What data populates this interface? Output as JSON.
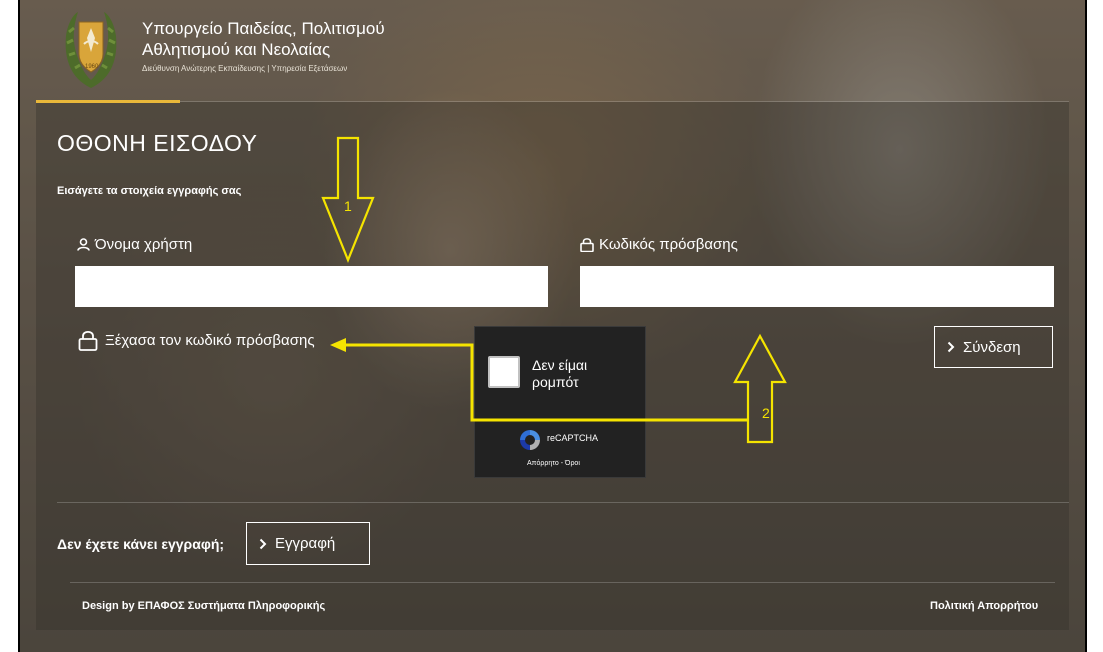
{
  "header": {
    "ministry_line1": "Υπουργείο Παιδείας, Πολιτισμού",
    "ministry_line2": "Αθλητισμού και Νεολαίας",
    "ministry_subline": "Διεύθυνση Ανώτερης Εκπαίδευσης | Υπηρεσία Εξετάσεων",
    "logo_icon": "cyprus-coat-of-arms-icon"
  },
  "login": {
    "title": "ΟΘΟΝΗ ΕΙΣΟΔΟΥ",
    "subtitle": "Εισάγετε τα στοιχεία εγγραφής σας",
    "username_label": "Όνομα χρήστη",
    "username_value": "",
    "password_label": "Κωδικός πρόσβασης",
    "password_value": "",
    "forgot_label": "Ξέχασα τον κωδικό πρόσβασης",
    "login_button": "Σύνδεση"
  },
  "recaptcha": {
    "checkbox_label": "Δεν είμαι ρομπότ",
    "brand": "reCAPTCHA",
    "terms": "Απόρρητο - Όροι"
  },
  "register": {
    "prompt": "Δεν έχετε κάνει εγγραφή;",
    "button": "Εγγραφή"
  },
  "footer": {
    "credit": "Design by ΕΠΑΦΟΣ Συστήματα Πληροφορικής",
    "privacy": "Πολιτική Απορρήτου"
  },
  "annotations": {
    "marker_1": "1",
    "marker_2": "2",
    "color": "#f5e400"
  },
  "colors": {
    "accent": "#e9b83a",
    "recaptcha_bg": "#222222"
  }
}
